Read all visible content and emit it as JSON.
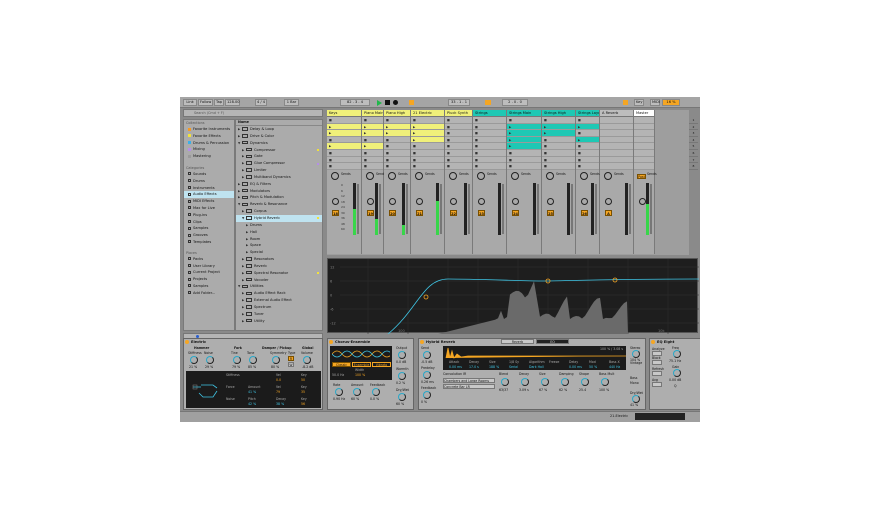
{
  "transport": {
    "link": "Link",
    "follow": "Follow",
    "tap": "Tap",
    "tempo": "128.00",
    "signature": "4 / 4",
    "quantize": "1 Bar",
    "position": "82 .  3 .  4",
    "loop_start": "33 .  1 .  1",
    "loop_length": "2 .  0 .  0",
    "key": "Key",
    "midi": "MIDI",
    "cpu": "16 %"
  },
  "browser": {
    "search_placeholder": "Search (Cmd + F)",
    "collections_title": "Collections",
    "collections": [
      {
        "label": "Favorite Instruments",
        "color": "#f59a23"
      },
      {
        "label": "Favorite Effects",
        "color": "#f2e23a"
      },
      {
        "label": "Drums & Percussion",
        "color": "#3ab0e8"
      },
      {
        "label": "Mixing",
        "color": "#b48ee8"
      },
      {
        "label": "Mastering",
        "color": "#9a9a9a"
      }
    ],
    "categories_title": "Categories",
    "categories": [
      "Sounds",
      "Drums",
      "Instruments",
      "Audio Effects",
      "MIDI Effects",
      "Max for Live",
      "Plug-ins",
      "Clips",
      "Samples",
      "Grooves",
      "Templates"
    ],
    "selected_category": "Audio Effects",
    "places_title": "Places",
    "places": [
      "Packs",
      "User Library",
      "Current Project",
      "Projects",
      "Samples",
      "Add Folder..."
    ],
    "list_header": "Name",
    "items": [
      {
        "label": "Delay & Loop",
        "level": 0,
        "folder": true
      },
      {
        "label": "Drive & Color",
        "level": 0,
        "folder": true
      },
      {
        "label": "Dynamics",
        "level": 0,
        "folder": true,
        "open": true
      },
      {
        "label": "Compressor",
        "level": 1,
        "tag": "#f2e23a"
      },
      {
        "label": "Gate",
        "level": 1
      },
      {
        "label": "Glue Compressor",
        "level": 1,
        "tag": "#b48ee8"
      },
      {
        "label": "Limiter",
        "level": 1
      },
      {
        "label": "Multiband Dynamics",
        "level": 1
      },
      {
        "label": "EQ & Filters",
        "level": 0,
        "folder": true
      },
      {
        "label": "Modulators",
        "level": 0,
        "folder": true
      },
      {
        "label": "Pitch & Modulation",
        "level": 0,
        "folder": true
      },
      {
        "label": "Reverb & Resonance",
        "level": 0,
        "folder": true,
        "open": true
      },
      {
        "label": "Corpus",
        "level": 1
      },
      {
        "label": "Hybrid Reverb",
        "level": 1,
        "open": true,
        "selected": true,
        "tag": "#f2e23a"
      },
      {
        "label": "Drums",
        "level": 2
      },
      {
        "label": "Hall",
        "level": 2
      },
      {
        "label": "Room",
        "level": 2
      },
      {
        "label": "Space",
        "level": 2
      },
      {
        "label": "Special",
        "level": 2
      },
      {
        "label": "Resonators",
        "level": 1
      },
      {
        "label": "Reverb",
        "level": 1
      },
      {
        "label": "Spectral Resonator",
        "level": 1,
        "tag": "#f2e23a"
      },
      {
        "label": "Vocoder",
        "level": 1
      },
      {
        "label": "Utilities",
        "level": 0,
        "folder": true,
        "open": true
      },
      {
        "label": "Audio Effect Rack",
        "level": 1
      },
      {
        "label": "External Audio Effect",
        "level": 1
      },
      {
        "label": "Spectrum",
        "level": 1
      },
      {
        "label": "Tuner",
        "level": 1
      },
      {
        "label": "Utility",
        "level": 1
      }
    ]
  },
  "session": {
    "sends_label": "Sends",
    "tracks": [
      {
        "name": "Keys",
        "color": "#f0f07a",
        "number": "18",
        "clips": [
          2,
          3,
          5
        ],
        "meter": 0.5
      },
      {
        "name": "Piano Main",
        "color": "#f0f07a",
        "number": "19",
        "clips": [
          2,
          3,
          5
        ],
        "meter": 0.3
      },
      {
        "name": "Piano High",
        "color": "#f0f07a",
        "number": "20",
        "clips": [
          2,
          3
        ],
        "meter": 0.2
      },
      {
        "name": "21 Electric",
        "color": "#f0f07a",
        "number": "21",
        "clips": [
          2,
          3,
          4
        ],
        "meter": 0.65,
        "selected": true
      },
      {
        "name": "Pluck Synth",
        "color": "#f0f07a",
        "number": "22",
        "clips": [],
        "meter": 0
      },
      {
        "name": "Strings",
        "color": "#1ec8b4",
        "number": "23",
        "clips": [],
        "meter": 0
      },
      {
        "name": "Strings Main",
        "color": "#1ec8b4",
        "number": "24",
        "clips": [
          2,
          3,
          4,
          5
        ],
        "meter": 0
      },
      {
        "name": "Strings High",
        "color": "#1ec8b4",
        "number": "25",
        "clips": [
          2,
          3
        ],
        "meter": 0
      },
      {
        "name": "Strings Layer",
        "color": "#1ec8b4",
        "number": "26",
        "clips": [
          2,
          4
        ],
        "meter": 0
      },
      {
        "name": "A Reverb",
        "color": "#bdbdbd",
        "number": "A",
        "clips": [],
        "meter": 0
      },
      {
        "name": "Master",
        "color": "#ffffff",
        "number": "",
        "clips": [],
        "meter": 0.6
      }
    ],
    "scenes": [
      "1",
      "2",
      "3",
      "4",
      "5",
      "6",
      "7",
      "8"
    ],
    "db_scale": [
      "0",
      "6",
      "12",
      "18",
      "24",
      "30",
      "36",
      "48",
      "60"
    ],
    "post_label": "Post"
  },
  "eq_display": {
    "y_labels": [
      "12",
      "6",
      "0",
      "-6",
      "-12"
    ],
    "x_labels": [
      "100",
      "1k",
      "10k"
    ],
    "curve_color": "#3fc6e6"
  },
  "devices": {
    "electric": {
      "title": "Electric",
      "sections": [
        "Hammer",
        "Fork",
        "Damper / Pickup",
        "Global"
      ],
      "knobs": [
        {
          "label": "Stiffness",
          "value": "21 %"
        },
        {
          "label": "Noise",
          "value": "29 %"
        },
        {
          "label": "Tine",
          "value": "79 %"
        },
        {
          "label": "Tone",
          "value": "85 %"
        },
        {
          "label": "Symmetry",
          "value": "80 %"
        },
        {
          "label": "Volume",
          "value": "-8.2 dB"
        }
      ],
      "type_label": "Type",
      "type_options": [
        "R",
        "W"
      ],
      "mod_rows": [
        {
          "name": "Stiffness",
          "amount_label": "",
          "amount": "",
          "vel": "0.0",
          "key": "50"
        },
        {
          "name": "Force",
          "amount_label": "Amount",
          "amount": "41 %",
          "vel": "79",
          "key": "35"
        },
        {
          "name": "Noise",
          "amount_label": "Pitch",
          "amount": "42 %",
          "vel_label": "Decay",
          "vel": "38 %",
          "key": "56"
        }
      ],
      "vel_label": "Vel",
      "key_label": "Key"
    },
    "chorus": {
      "title": "Chorus-Ensemble",
      "modes": [
        "Classic",
        "Ensemble",
        "Vibrato"
      ],
      "hp": "50.0 Hz",
      "width_label": "Width",
      "width": "100 %",
      "knobs": [
        {
          "label": "Output",
          "value": "0.0 dB"
        },
        {
          "label": "Warmth",
          "value": "0.2 %"
        },
        {
          "label": "Dry/Wet",
          "value": "60 %"
        },
        {
          "label": "Rate",
          "value": "0.90 Hz"
        },
        {
          "label": "Amount",
          "value": "60 %"
        },
        {
          "label": "Feedback",
          "value": "0.0 %"
        }
      ]
    },
    "reverb": {
      "title": "Hybrid Reverb",
      "tabs": [
        "Reverb",
        "EQ"
      ],
      "readout": "100 % / 3.08 s",
      "left": [
        {
          "label": "Send",
          "value": "-0.5 dB"
        },
        {
          "label": "Predelay",
          "value": "0.26 ms"
        },
        {
          "label": "Feedback",
          "value": "0 %"
        }
      ],
      "params": [
        {
          "label": "Attack",
          "value": "0.00 ms"
        },
        {
          "label": "Decay",
          "value": "17.0 s"
        },
        {
          "label": "Size",
          "value": "188 %"
        },
        {
          "label": "1/8 Sy",
          "value": "Serial"
        },
        {
          "label": "Algorithm",
          "value": "Dark Hall"
        },
        {
          "label": "Freeze",
          "value": ""
        },
        {
          "label": "Delay",
          "value": "0.00 ms"
        },
        {
          "label": "Mod",
          "value": "50 %"
        },
        {
          "label": "Bass X",
          "value": "440 Hz"
        }
      ],
      "conv_label": "Convolution IR",
      "ir_category": "Chambers and Large Rooms",
      "ir_name": "Concrete Bar LR",
      "knobs": [
        {
          "label": "Blend",
          "value": "63/37"
        },
        {
          "label": "Decay",
          "value": "3.09 s"
        },
        {
          "label": "Size",
          "value": "67 %"
        },
        {
          "label": "Damping",
          "value": "62 %"
        },
        {
          "label": "Shape",
          "value": "25.4"
        },
        {
          "label": "Bass Mult",
          "value": "100 %"
        }
      ],
      "right": [
        {
          "label": "Stereo",
          "value": "104 %"
        },
        {
          "label": "Vintage",
          "value": ""
        },
        {
          "label": "Bass",
          "value": "Mono"
        },
        {
          "label": "Dry/Wet",
          "value": "41 %"
        }
      ]
    },
    "eq8": {
      "title": "EQ Eight",
      "analyze": "Analyze",
      "block": "Block",
      "refresh": "Refresh",
      "avg": "Avg",
      "freq_label": "Freq",
      "freq": "75.1 Hz",
      "gain_label": "Gain",
      "gain": "0.00 dB",
      "q_label": "Q"
    }
  },
  "status": {
    "selected_track": "21-Electric"
  }
}
